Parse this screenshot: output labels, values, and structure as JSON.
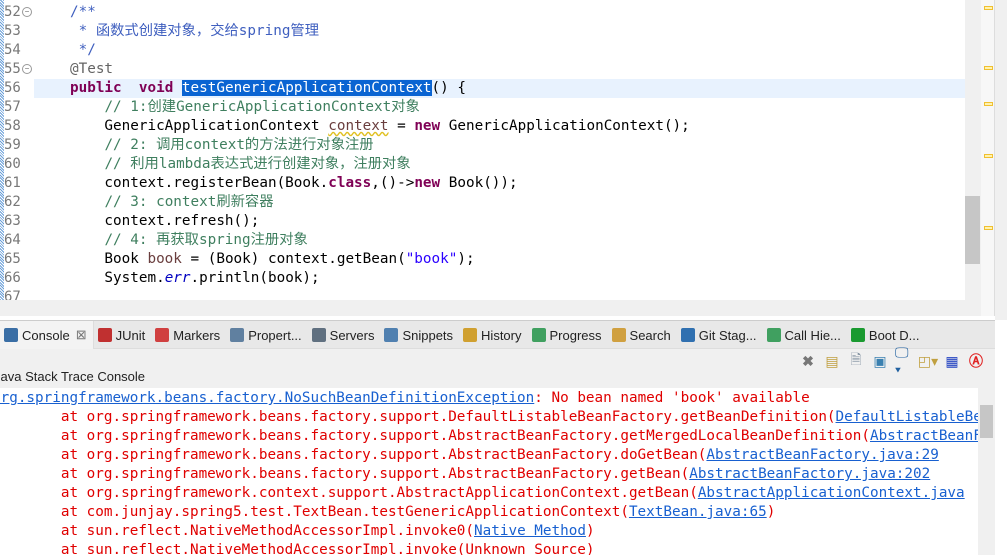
{
  "editor": {
    "lines": [
      {
        "n": "52",
        "fold": true,
        "t": [
          [
            "d",
            "/**"
          ]
        ]
      },
      {
        "n": "53",
        "t": [
          [
            "d",
            " * 函数式创建对象，交给spring管理"
          ]
        ]
      },
      {
        "n": "54",
        "t": [
          [
            "d",
            " */"
          ]
        ]
      },
      {
        "n": "55",
        "fold": true,
        "t": [
          [
            "a",
            "@Test"
          ]
        ]
      },
      {
        "n": "56",
        "current": true,
        "t": [
          [
            "k",
            "public"
          ],
          [
            "",
            "  "
          ],
          [
            "k",
            "void"
          ],
          [
            "",
            " "
          ],
          [
            "sel",
            "testGenericApplicationContext"
          ],
          [
            "",
            "() {"
          ]
        ]
      },
      {
        "n": "57",
        "t": [
          [
            "",
            "    "
          ],
          [
            "c",
            "// 1:创建GenericApplicationContext对象"
          ]
        ]
      },
      {
        "n": "58",
        "t": [
          [
            "",
            "    GenericApplicationContext "
          ],
          [
            "v warn",
            "context"
          ],
          [
            "",
            " = "
          ],
          [
            "k",
            "new"
          ],
          [
            "",
            " GenericApplicationContext();"
          ]
        ]
      },
      {
        "n": "59",
        "t": [
          [
            "",
            "    "
          ],
          [
            "c",
            "// 2: 调用context的方法进行对象注册"
          ]
        ]
      },
      {
        "n": "60",
        "t": [
          [
            "",
            "    "
          ],
          [
            "c",
            "// 利用lambda表达式进行创建对象，注册对象"
          ]
        ]
      },
      {
        "n": "61",
        "t": [
          [
            "",
            "    context.registerBean(Book."
          ],
          [
            "k",
            "class"
          ],
          [
            "",
            ",()->"
          ],
          [
            "k",
            "new"
          ],
          [
            "",
            " Book());"
          ]
        ]
      },
      {
        "n": "62",
        "t": [
          [
            "",
            "    "
          ],
          [
            "c",
            "// 3: context刷新容器"
          ]
        ]
      },
      {
        "n": "63",
        "t": [
          [
            "",
            "    context.refresh();"
          ]
        ]
      },
      {
        "n": "64",
        "t": [
          [
            "",
            "    "
          ],
          [
            "c",
            "// 4: 再获取spring注册对象"
          ]
        ]
      },
      {
        "n": "65",
        "t": [
          [
            "",
            "    Book "
          ],
          [
            "v",
            "book"
          ],
          [
            "",
            " = (Book) context.getBean("
          ],
          [
            "s",
            "\"book\""
          ],
          [
            "",
            ");"
          ]
        ]
      },
      {
        "n": "66",
        "t": [
          [
            "",
            "    System."
          ],
          [
            "f",
            "err"
          ],
          [
            "",
            ".println(book);"
          ]
        ]
      },
      {
        "n": "67",
        "t": [
          [
            "",
            ""
          ]
        ]
      }
    ]
  },
  "panel": {
    "tabs": [
      {
        "label": "Console",
        "close": "⊠",
        "icon": "console-icon",
        "color": "#3a6ea5"
      },
      {
        "label": "JUnit",
        "icon": "junit-icon",
        "color": "#c03030"
      },
      {
        "label": "Markers",
        "icon": "markers-icon",
        "color": "#d04040"
      },
      {
        "label": "Propert...",
        "icon": "properties-icon",
        "color": "#6080a0"
      },
      {
        "label": "Servers",
        "icon": "servers-icon",
        "color": "#607080"
      },
      {
        "label": "Snippets",
        "icon": "snippets-icon",
        "color": "#5080b0"
      },
      {
        "label": "History",
        "icon": "history-icon",
        "color": "#d0a030"
      },
      {
        "label": "Progress",
        "icon": "progress-icon",
        "color": "#40a060"
      },
      {
        "label": "Search",
        "icon": "search-icon",
        "color": "#d0a040"
      },
      {
        "label": "Git Stag...",
        "icon": "git-staging-icon",
        "color": "#3070b0"
      },
      {
        "label": "Call Hie...",
        "icon": "call-hierarchy-icon",
        "color": "#40a060"
      },
      {
        "label": "Boot D...",
        "icon": "boot-dashboard-icon",
        "color": "#1a9a30"
      }
    ],
    "console_title": "Java Stack Trace Console",
    "output": [
      [
        [
          "lnk",
          "org.springframework.beans.factory.NoSuchBeanDefinitionException"
        ],
        [
          "err",
          ": No bean named 'book' available"
        ]
      ],
      [
        [
          "err",
          "\tat org.springframework.beans.factory.support.DefaultListableBeanFactory.getBeanDefinition("
        ],
        [
          "lnk",
          "DefaultListableBeanFactory.java"
        ]
      ],
      [
        [
          "err",
          "\tat org.springframework.beans.factory.support.AbstractBeanFactory.getMergedLocalBeanDefinition("
        ],
        [
          "lnk",
          "AbstractBeanFactory.java"
        ]
      ],
      [
        [
          "err",
          "\tat org.springframework.beans.factory.support.AbstractBeanFactory.doGetBean("
        ],
        [
          "lnk",
          "AbstractBeanFactory.java:29"
        ]
      ],
      [
        [
          "err",
          "\tat org.springframework.beans.factory.support.AbstractBeanFactory.getBean("
        ],
        [
          "lnk",
          "AbstractBeanFactory.java:202"
        ]
      ],
      [
        [
          "err",
          "\tat org.springframework.context.support.AbstractApplicationContext.getBean("
        ],
        [
          "lnk",
          "AbstractApplicationContext.java"
        ]
      ],
      [
        [
          "err",
          "\tat com.junjay.spring5.test.TextBean.testGenericApplicationContext("
        ],
        [
          "lnk",
          "TextBean.java:65"
        ],
        [
          "err",
          ")"
        ]
      ],
      [
        [
          "err",
          "\tat sun.reflect.NativeMethodAccessorImpl.invoke0("
        ],
        [
          "lnk",
          "Native Method"
        ],
        [
          "err",
          ")"
        ]
      ],
      [
        [
          "err",
          "\tat sun.reflect.NativeMethodAccessorImpl.invoke(Unknown Source)"
        ]
      ]
    ]
  }
}
